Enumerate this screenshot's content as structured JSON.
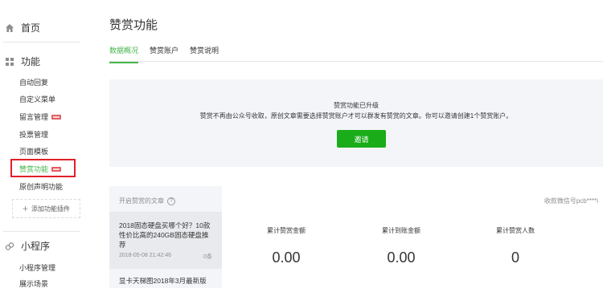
{
  "sidebar": {
    "home": "首页",
    "function_section": "功能",
    "items": [
      {
        "label": "自动回复",
        "new": false
      },
      {
        "label": "自定义菜单",
        "new": false
      },
      {
        "label": "留言管理",
        "new": true
      },
      {
        "label": "投票管理",
        "new": false
      },
      {
        "label": "页面模板",
        "new": false
      },
      {
        "label": "赞赏功能",
        "new": true,
        "active": true
      },
      {
        "label": "原创声明功能",
        "new": false
      }
    ],
    "add_plugin": "添加功能插件",
    "miniprogram_section": "小程序",
    "mini_items": [
      "小程序管理",
      "展示场景"
    ]
  },
  "page": {
    "title": "赞赏功能",
    "tabs": [
      "数据概况",
      "赞赏账户",
      "赞赏说明"
    ]
  },
  "upgrade": {
    "title": "赞赏功能已升级",
    "desc": "赞赏不再由公众号收取，原创文章需要选择赞赏账户才可以群发有赞赏的文章。你可以邀请创建1个赞赏账户。",
    "button": "邀请"
  },
  "articles": {
    "header": "开启赞赏的文章",
    "items": [
      {
        "title": "2018固态硬盘买哪个好？10款性价比高的240GB固态硬盘推荐",
        "date": "2018-05-08 21:42:46",
        "count": "0条"
      },
      {
        "title": "显卡天梯图2018年3月最新版"
      }
    ]
  },
  "stats": {
    "receiver": "收款微信号pcb****i",
    "items": [
      {
        "label": "累计赞赏金额",
        "value": "0.00"
      },
      {
        "label": "累计到账金额",
        "value": "0.00"
      },
      {
        "label": "累计赞赏人数",
        "value": "0"
      }
    ]
  },
  "colors": {
    "accent": "#44b549",
    "button": "#1aad19",
    "highlight": "#e0202a",
    "badge": "#e15f63"
  }
}
